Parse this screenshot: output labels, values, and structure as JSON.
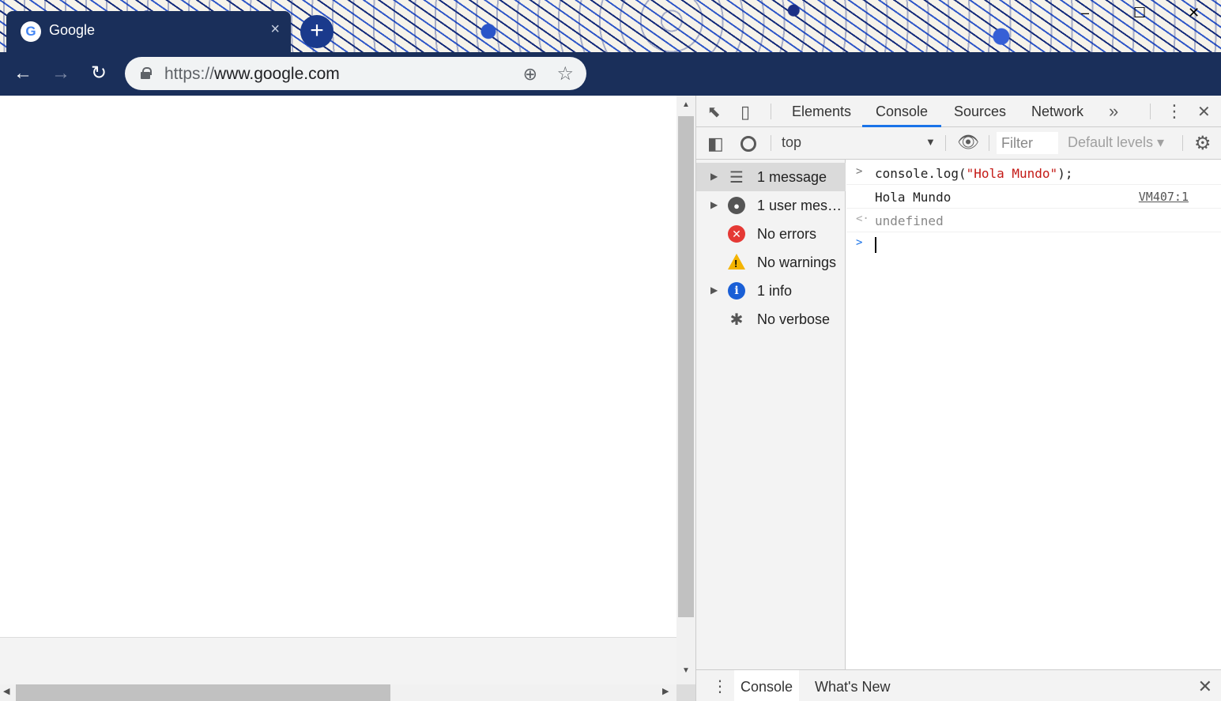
{
  "browser": {
    "tab": {
      "favicon": "google-g-icon",
      "title": "Google",
      "close": "×"
    },
    "new_tab": "+",
    "window_controls": {
      "minimize": "–",
      "maximize": "☐",
      "close": "✕"
    },
    "nav": {
      "back": "←",
      "forward": "→",
      "reload": "↻"
    },
    "omnibox": {
      "scheme": "https://",
      "host": "www.google.com",
      "location_icon": "⊕",
      "star": "☆"
    }
  },
  "devtools": {
    "toolbar_icons": {
      "inspect": "⬉",
      "device": "▯",
      "more_tabs": "»",
      "menu": "⋮",
      "close": "✕"
    },
    "tabs": [
      {
        "label": "Elements"
      },
      {
        "label": "Console"
      },
      {
        "label": "Sources"
      },
      {
        "label": "Network"
      }
    ],
    "active_tab": "Console",
    "console_toolbar": {
      "sidebar_toggle": "◧",
      "clear": "⃠",
      "context": "top",
      "context_arrow": "▼",
      "eye": "👁",
      "filter_placeholder": "Filter",
      "levels": "Default levels ▾",
      "settings": "⚙"
    },
    "sidebar": {
      "items": [
        {
          "label": "1 message",
          "icon": "list-icon",
          "glyph": "☰",
          "expandable": true,
          "selected": true
        },
        {
          "label": "1 user mess...",
          "icon": "user-icon",
          "glyph": "●",
          "expandable": true,
          "selected": false
        },
        {
          "label": "No errors",
          "icon": "error-icon",
          "glyph": "✕",
          "expandable": false,
          "selected": false
        },
        {
          "label": "No warnings",
          "icon": "warning-icon",
          "glyph": "!",
          "expandable": false,
          "selected": false
        },
        {
          "label": "1 info",
          "icon": "info-icon",
          "glyph": "i",
          "expandable": true,
          "selected": false
        },
        {
          "label": "No verbose",
          "icon": "bug-icon",
          "glyph": "✱",
          "expandable": false,
          "selected": false
        }
      ]
    },
    "console": {
      "input_prefix": "console.log(",
      "input_string": "\"Hola Mundo\"",
      "input_suffix": ");",
      "output": "Hola Mundo",
      "output_source": "VM407:1",
      "return_value": "undefined",
      "input_chevron": ">",
      "return_chevron": "<·",
      "prompt_chevron": ">"
    },
    "drawer": {
      "menu": "⋮",
      "tabs": [
        "Console",
        "What's New"
      ],
      "close": "✕"
    }
  },
  "colors": {
    "toolbar": "#1a2f5a",
    "accent": "#1a73e8",
    "error": "#e53935",
    "warning": "#f4b400",
    "info": "#1a5fd6",
    "string": "#c41a16"
  }
}
